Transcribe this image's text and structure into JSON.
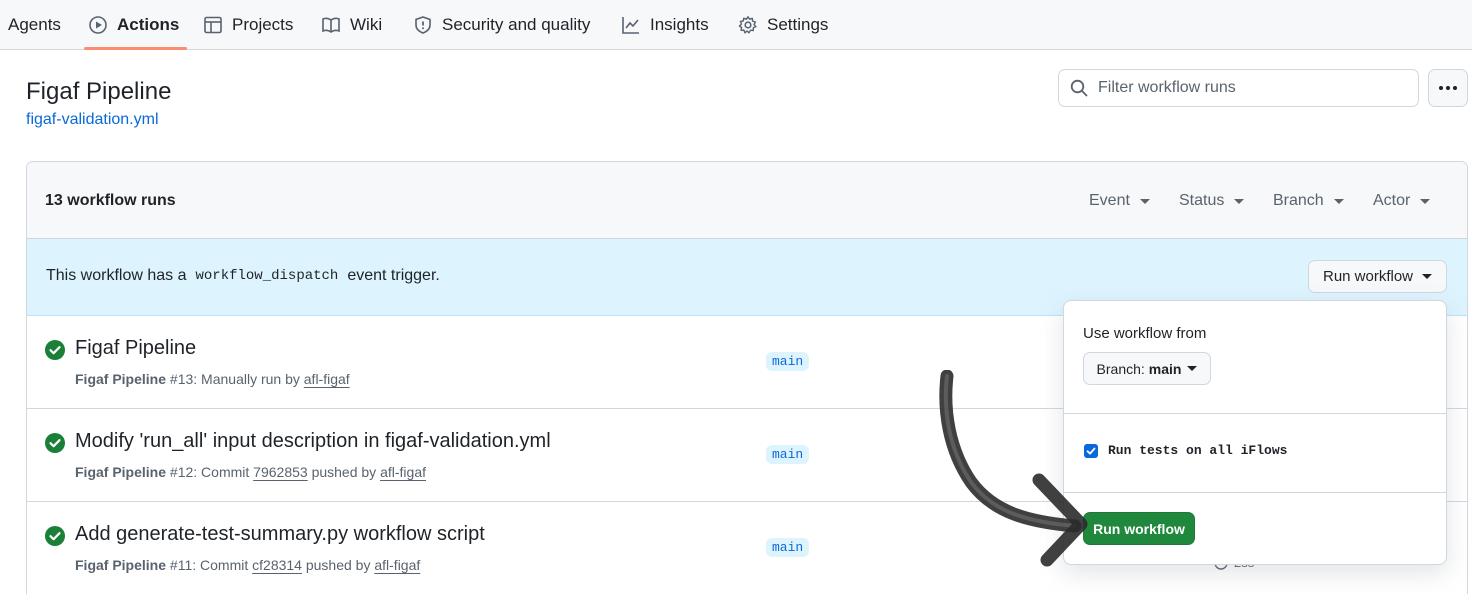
{
  "nav": {
    "tabs": [
      {
        "label": "Agents",
        "icon": "none"
      },
      {
        "label": "Actions",
        "icon": "play-icon",
        "active": true
      },
      {
        "label": "Projects",
        "icon": "table-icon"
      },
      {
        "label": "Wiki",
        "icon": "book-icon"
      },
      {
        "label": "Security and quality",
        "icon": "shield-icon"
      },
      {
        "label": "Insights",
        "icon": "graph-icon"
      },
      {
        "label": "Settings",
        "icon": "gear-icon"
      }
    ]
  },
  "header": {
    "title": "Figaf Pipeline",
    "workflow_file": "figaf-validation.yml",
    "filter_placeholder": "Filter workflow runs"
  },
  "runs_box": {
    "count_label": "13 workflow runs",
    "filters": [
      "Event",
      "Status",
      "Branch",
      "Actor"
    ]
  },
  "banner": {
    "text_before": "This workflow has a",
    "code": "workflow_dispatch",
    "text_after": "event trigger.",
    "run_button_label": "Run workflow"
  },
  "runs": [
    {
      "title": "Figaf Pipeline",
      "workflow": "Figaf Pipeline",
      "number": "#13:",
      "desc": "Manually run by",
      "commit": "",
      "desc_after": "",
      "actor": "afl-figaf",
      "branch": "main",
      "status": "success"
    },
    {
      "title": "Modify 'run_all' input description in figaf-validation.yml",
      "workflow": "Figaf Pipeline",
      "number": "#12:",
      "desc": "Commit",
      "commit": "7962853",
      "desc_after": "pushed by",
      "actor": "afl-figaf",
      "branch": "main",
      "status": "success"
    },
    {
      "title": "Add generate-test-summary.py workflow script",
      "workflow": "Figaf Pipeline",
      "number": "#11:",
      "desc": "Commit",
      "commit": "cf28314",
      "desc_after": "pushed by",
      "actor": "afl-figaf",
      "branch": "main",
      "status": "success"
    }
  ],
  "dropdown": {
    "use_from_label": "Use workflow from",
    "branch_prefix": "Branch:",
    "branch_value": "main",
    "checkbox_label": "Run tests on all iFlows",
    "checkbox_checked": true,
    "submit_label": "Run workflow"
  },
  "partial_duration": "2ss",
  "colors": {
    "accent_underline": "#fd8c73",
    "success": "#1a7f37",
    "link": "#0969da",
    "submit_bg": "#1f883d",
    "banner_bg": "#ddf4ff"
  }
}
